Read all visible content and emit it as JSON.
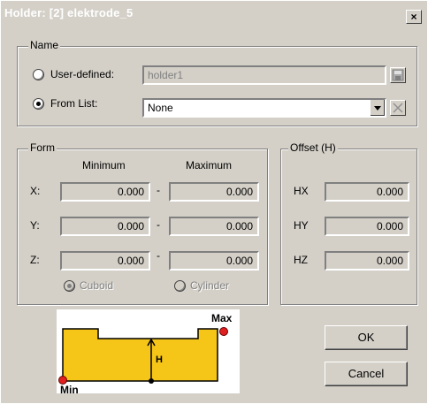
{
  "window": {
    "title": "Holder: [2] elektrode_5",
    "close_glyph": "×"
  },
  "name_group": {
    "label": "Name",
    "user_defined": {
      "label": "User-defined:",
      "value": "holder1"
    },
    "from_list": {
      "label": "From List:",
      "selected": "None"
    }
  },
  "form_group": {
    "label": "Form",
    "col_min": "Minimum",
    "col_max": "Maximum",
    "rows": [
      {
        "axis": "X:",
        "min": "0.000",
        "max": "0.000"
      },
      {
        "axis": "Y:",
        "min": "0.000",
        "max": "0.000"
      },
      {
        "axis": "Z:",
        "min": "0.000",
        "max": "0.000"
      }
    ],
    "separator": "-",
    "shape_cuboid": "Cuboid",
    "shape_cylinder": "Cylinder"
  },
  "offset_group": {
    "label": "Offset (H)",
    "rows": [
      {
        "axis": "HX",
        "value": "0.000"
      },
      {
        "axis": "HY",
        "value": "0.000"
      },
      {
        "axis": "HZ",
        "value": "0.000"
      }
    ]
  },
  "diagram": {
    "max_label": "Max",
    "min_label": "Min",
    "h_label": "H",
    "fill_color": "#f5c518",
    "point_color": "#e02020"
  },
  "buttons": {
    "ok": "OK",
    "cancel": "Cancel"
  },
  "colors": {
    "titlebar_text": "#ffffff",
    "dialog_bg": "#d4d0c8"
  }
}
